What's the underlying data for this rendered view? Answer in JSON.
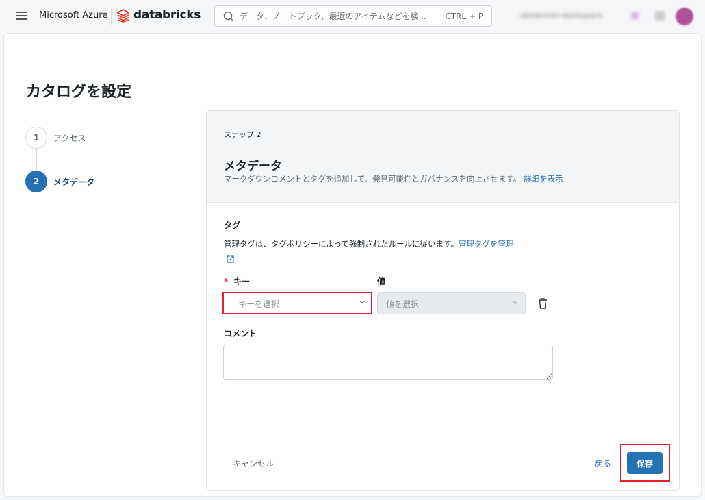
{
  "header": {
    "brand": "Microsoft Azure",
    "product": "databricks",
    "search_placeholder": "データ、ノートブック、最近のアイテムなどを検...",
    "search_shortcut": "CTRL + P",
    "workspace": "databricks-workspace"
  },
  "page": {
    "title": "カタログを設定"
  },
  "steps": [
    {
      "num": "1",
      "label": "アクセス",
      "active": false
    },
    {
      "num": "2",
      "label": "メタデータ",
      "active": true
    }
  ],
  "card": {
    "step_label": "ステップ 2",
    "title": "メタデータ",
    "description": "マークダウンコメントとタグを追加して、発見可能性とガバナンスを向上させます。",
    "details_link": "詳細を表示",
    "tags_label": "タグ",
    "tags_help": "管理タグは、タグポリシーによって強制されたルールに従います。",
    "manage_tags_link": "管理タグを管理",
    "key_label": "キー",
    "key_required": "*",
    "key_placeholder": "キーを選択",
    "value_label": "値",
    "value_placeholder": "値を選択",
    "comment_label": "コメント",
    "comment_value": ""
  },
  "footer": {
    "cancel": "キャンセル",
    "back": "戻る",
    "save": "保存"
  },
  "colors": {
    "accent": "#2272b4",
    "highlight": "#e8202a"
  }
}
